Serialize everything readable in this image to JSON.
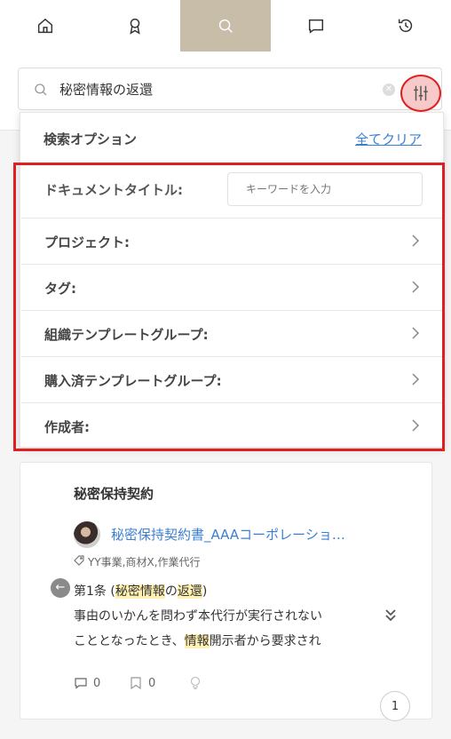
{
  "nav": {
    "tabs": [
      "home",
      "award",
      "search",
      "comment",
      "history"
    ],
    "active": "search"
  },
  "search": {
    "query": "秘密情報の返還"
  },
  "filter_panel": {
    "title": "検索オプション",
    "clear_all": "全てクリア",
    "options": [
      {
        "label": "ドキュメントタイトル:",
        "type": "input",
        "placeholder": "キーワードを入力"
      },
      {
        "label": "プロジェクト:",
        "type": "select"
      },
      {
        "label": "タグ:",
        "type": "select"
      },
      {
        "label": "組織テンプレートグループ:",
        "type": "select"
      },
      {
        "label": "購入済テンプレートグループ:",
        "type": "select"
      },
      {
        "label": "作成者:",
        "type": "select"
      }
    ]
  },
  "result": {
    "category": "秘密保持契約",
    "doc_title": "秘密保持契約書_AAAコーポレーショ…",
    "tags": "YY事業,商材X,作業代行",
    "article": {
      "prefix": "第1条 (",
      "hl1": "秘密情報",
      "mid": "の",
      "hl2": "返還",
      "suffix": ")"
    },
    "line1": "事由のいかんを問わず本代行が実行されない",
    "line2": {
      "before": "こととなったとき、",
      "hl": "情報",
      "after": "開示者から要求され"
    },
    "comments": "0",
    "bookmarks": "0"
  },
  "pagination": {
    "page": "1"
  },
  "colors": {
    "accent_tab": "#c7bda9",
    "highlight_red": "#e02020",
    "link": "#3b7fd3",
    "text_highlight": "#fff0b3"
  }
}
